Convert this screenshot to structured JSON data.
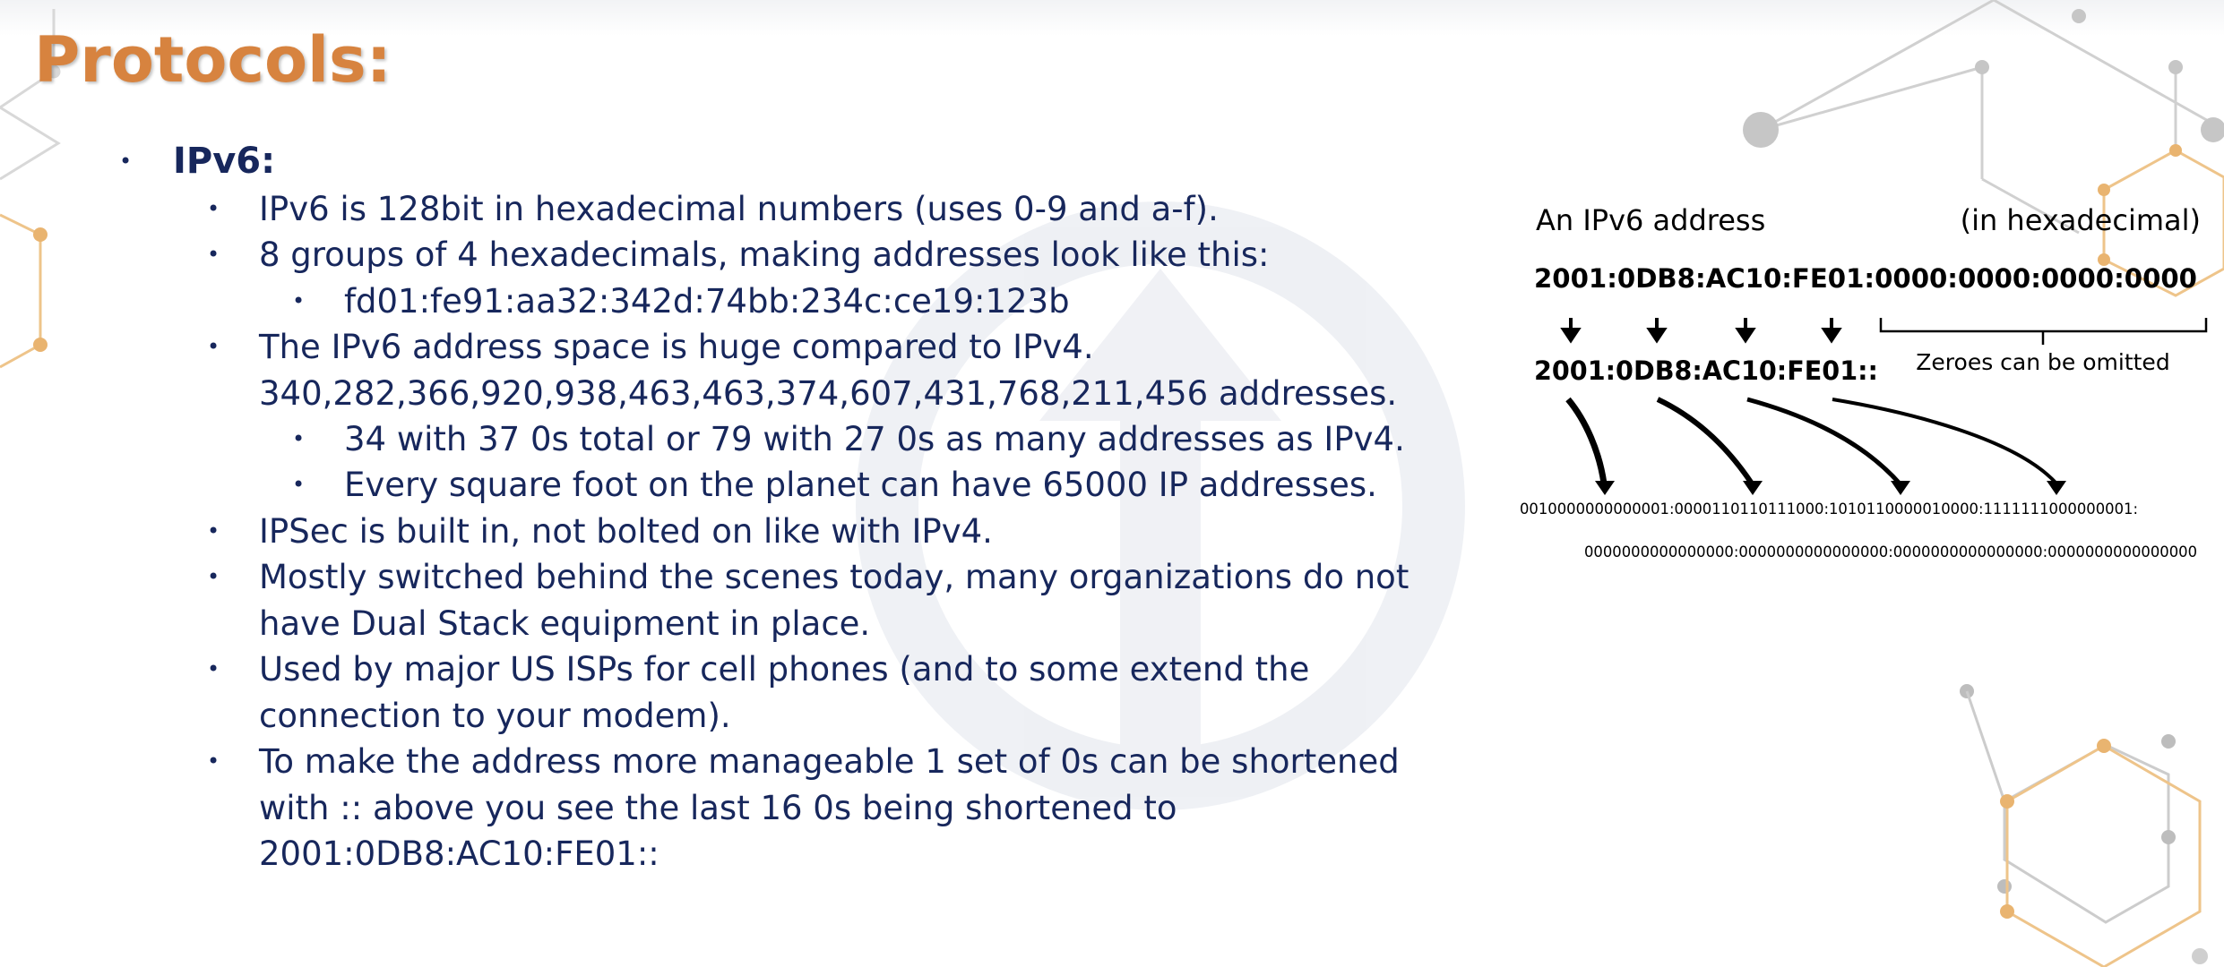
{
  "slide": {
    "title": "Protocols:"
  },
  "bullets": {
    "ipv6": "IPv6:",
    "item1": "IPv6 is 128bit in hexadecimal numbers (uses 0-9 and a-f).",
    "item2": "8 groups of 4 hexadecimals, making addresses look like this:",
    "item2_sub1": "fd01:fe91:aa32:342d:74bb:234c:ce19:123b",
    "item3_line1": "The IPv6 address space is huge compared to IPv4.",
    "item3_line2": "340,282,366,920,938,463,463,374,607,431,768,211,456  addresses.",
    "item3_sub1": "34 with 37 0s total or 79 with 27 0s as many addresses as IPv4.",
    "item3_sub2": "Every square foot on the planet can have 65000 IP addresses.",
    "item4": "IPSec is built in, not bolted on like with IPv4.",
    "item5_line1": "Mostly switched behind the scenes today, many organizations do not",
    "item5_line2": "have Dual Stack equipment in place.",
    "item6_line1": "Used by major US ISPs for cell phones (and to some extend the",
    "item6_line2": "connection to your modem).",
    "item7_line1": "To make the address more manageable 1 set of 0s can be shortened",
    "item7_line2": "with :: above you see the last 16 0s being shortened to",
    "item7_line3": "2001:0DB8:AC10:FE01::"
  },
  "diagram": {
    "header_left": "An IPv6 address",
    "header_right": "(in hexadecimal)",
    "full_address": "2001:0DB8:AC10:FE01:0000:0000:0000:0000",
    "short_address": "2001:0DB8:AC10:FE01::",
    "omitted_note": "Zeroes can be omitted",
    "binary_line1": "0010000000000001:0000110110111000:1010110000010000:1111111000000001:",
    "binary_line2": "0000000000000000:0000000000000000:0000000000000000:0000000000000000"
  },
  "colors": {
    "title": "#d7833f",
    "body_text": "#17275c",
    "hex_orange": "#e9b470",
    "hex_gray": "#c8c8c8",
    "watermark": "#dfe3ea"
  }
}
